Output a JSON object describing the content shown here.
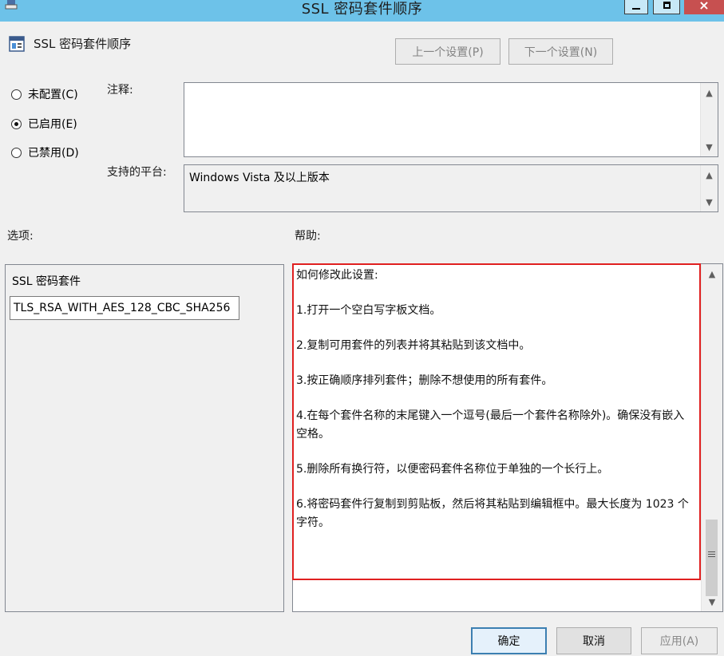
{
  "window": {
    "title": "SSL 密码套件顺序",
    "close_glyph": "×"
  },
  "header": {
    "title": "SSL 密码套件顺序",
    "prev_button": "上一个设置(P)",
    "next_button": "下一个设置(N)"
  },
  "state": {
    "options": [
      {
        "label": "未配置(C)",
        "selected": false
      },
      {
        "label": "已启用(E)",
        "selected": true
      },
      {
        "label": "已禁用(D)",
        "selected": false
      }
    ]
  },
  "comment": {
    "label": "注释:",
    "value": ""
  },
  "platform": {
    "label": "支持的平台:",
    "value": "Windows Vista 及以上版本"
  },
  "options_panel": {
    "label": "选项:",
    "field_label": "SSL 密码套件",
    "field_value": "TLS_RSA_WITH_AES_128_CBC_SHA256"
  },
  "help_panel": {
    "label": "帮助:",
    "paragraphs": [
      "如何修改此设置:",
      "1.打开一个空白写字板文档。",
      "2.复制可用套件的列表并将其粘贴到该文档中。",
      "3.按正确顺序排列套件；删除不想使用的所有套件。",
      "4.在每个套件名称的末尾键入一个逗号(最后一个套件名称除外)。确保没有嵌入空格。",
      "5.删除所有换行符，以便密码套件名称位于单独的一个长行上。",
      "6.将密码套件行复制到剪贴板，然后将其粘贴到编辑框中。最大长度为 1023 个字符。"
    ]
  },
  "footer": {
    "ok": "确定",
    "cancel": "取消",
    "apply": "应用(A)"
  },
  "colors": {
    "titlebar": "#6dc2e9",
    "highlight": "#e02020"
  }
}
